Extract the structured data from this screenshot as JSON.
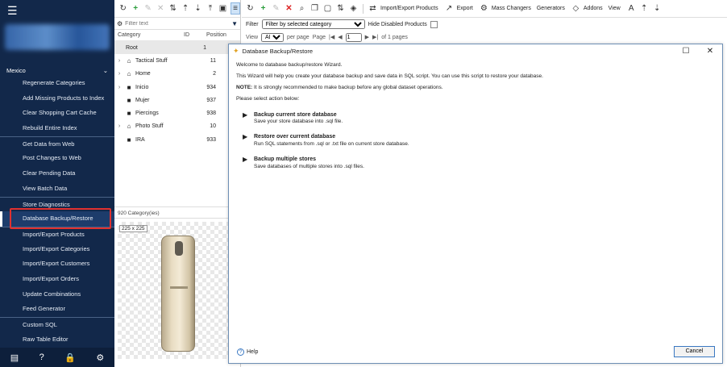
{
  "sidebar": {
    "store_name": "Mexico",
    "menu": [
      "Regenerate Categories",
      "Add Missing Products to Index",
      "Clear Shopping Cart Cache",
      "Rebuild Entire Index",
      "Get Data from Web",
      "Post Changes to Web",
      "Clear Pending Data",
      "View Batch Data",
      "Store Diagnostics",
      "Database Backup/Restore",
      "Import/Export Products",
      "Import/Export Categories",
      "Import/Export Customers",
      "Import/Export Orders",
      "Update Combinations",
      "Feed Generator",
      "Custom SQL",
      "Raw Table Editor"
    ]
  },
  "left_panel": {
    "filter_placeholder": "Filter text",
    "columns": [
      "Category",
      "ID",
      "Position"
    ],
    "rows": [
      {
        "name": "Root",
        "id": "",
        "pos": "1"
      },
      {
        "name": "Tactical Stuff",
        "id": "",
        "pos": "11"
      },
      {
        "name": "Home",
        "id": "",
        "pos": "2"
      },
      {
        "name": "Inicio",
        "id": "",
        "pos": "934"
      },
      {
        "name": "Mujer",
        "id": "",
        "pos": "937"
      },
      {
        "name": "Piercings",
        "id": "",
        "pos": "938"
      },
      {
        "name": "Photo Stuff",
        "id": "",
        "pos": "10"
      },
      {
        "name": "IRA",
        "id": "",
        "pos": "933"
      }
    ],
    "count_label": "920 Category(ies)",
    "image_size": "225 x 225"
  },
  "right_toolbar": {
    "import_export": "Import/Export Products",
    "export": "Export",
    "mass_changers": "Mass Changers",
    "generators": "Generators",
    "addons": "Addons",
    "view": "View"
  },
  "filter_bar": {
    "filter_label": "Filter",
    "filter_value": "Filter by selected category",
    "hide_disabled": "Hide Disabled Products"
  },
  "pager": {
    "view_label": "View",
    "view_value": "ALL",
    "per_page": "per page",
    "page_label": "Page",
    "page_value": "1",
    "of_pages": "of 1 pages"
  },
  "dialog": {
    "title": "Database Backup/Restore",
    "intro": "Welcome to database backup/restore Wizard.",
    "desc": "This Wizard will help you create your database backup and save data in SQL script. You can use this script to restore your database.",
    "note_label": "NOTE:",
    "note": " It is strongly recommended to make backup before any global dataset operations.",
    "select": "Please select action below:",
    "options": [
      {
        "title": "Backup current store database",
        "desc": "Save your store database into .sql file."
      },
      {
        "title": "Restore over current database",
        "desc": "Run SQL statements from .sql or .txt file on current store database."
      },
      {
        "title": "Backup multiple stores",
        "desc": "Save databases of multiple stores into .sql files."
      }
    ],
    "help": "Help",
    "cancel": "Cancel"
  }
}
